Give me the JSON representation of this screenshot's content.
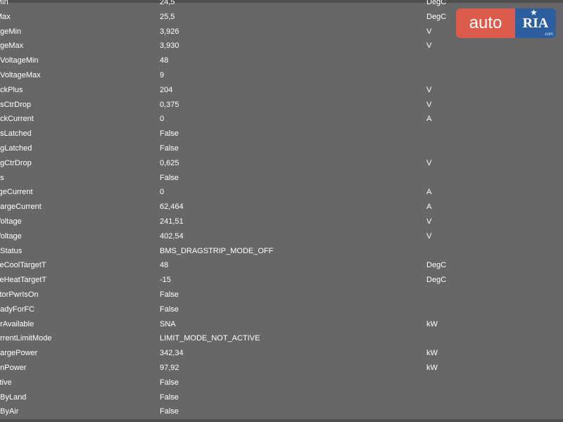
{
  "logo": {
    "brand_left": "auto",
    "brand_right": "RIA",
    "star_glyph": "★",
    "suffix": ".com",
    "color_left": "#db5c4c",
    "color_right": "#2c5ea0"
  },
  "rows": [
    {
      "name": "Min",
      "value": "24,5",
      "unit": "DegC"
    },
    {
      "name": "Max",
      "value": "25,5",
      "unit": "DegC"
    },
    {
      "name": "ageMin",
      "value": "3,926",
      "unit": "V"
    },
    {
      "name": "ageMax",
      "value": "3,930",
      "unit": "V"
    },
    {
      "name": "nVoltageMin",
      "value": "48",
      "unit": ""
    },
    {
      "name": "nVoltageMax",
      "value": "9",
      "unit": ""
    },
    {
      "name": "ackPlus",
      "value": "204",
      "unit": "V"
    },
    {
      "name": "osCtrDrop",
      "value": "0,375",
      "unit": "V"
    },
    {
      "name": "ackCurrent",
      "value": "0",
      "unit": "A"
    },
    {
      "name": "osLatched",
      "value": "False",
      "unit": ""
    },
    {
      "name": "egLatched",
      "value": "False",
      "unit": ""
    },
    {
      "name": "egCtrDrop",
      "value": "0,625",
      "unit": "V"
    },
    {
      "name": "os",
      "value": "False",
      "unit": ""
    },
    {
      "name": "rgeCurrent",
      "value": "0",
      "unit": "A"
    },
    {
      "name": "hargeCurrent",
      "value": "62,464",
      "unit": "A"
    },
    {
      "name": "Voltage",
      "value": "241,51",
      "unit": "V"
    },
    {
      "name": "Voltage",
      "value": "402,54",
      "unit": "V"
    },
    {
      "name": "pStatus",
      "value": "BMS_DRAGSTRIP_MODE_OFF",
      "unit": ""
    },
    {
      "name": "veCoolTargetT",
      "value": "48",
      "unit": "DegC"
    },
    {
      "name": "veHeatTargetT",
      "value": "-15",
      "unit": "DegC"
    },
    {
      "name": "ctorPwrIsOn",
      "value": "False",
      "unit": ""
    },
    {
      "name": "eadyForFC",
      "value": "False",
      "unit": ""
    },
    {
      "name": "erAvailable",
      "value": "SNA",
      "unit": "kW"
    },
    {
      "name": "urrentLimitMode",
      "value": "LIMIT_MODE_NOT_ACTIVE",
      "unit": ""
    },
    {
      "name": "hargePower",
      "value": "342,34",
      "unit": "kW"
    },
    {
      "name": "enPower",
      "value": "97,92",
      "unit": "kW"
    },
    {
      "name": "ctive",
      "value": "False",
      "unit": ""
    },
    {
      "name": "pByLand",
      "value": "False",
      "unit": ""
    },
    {
      "name": "pByAir",
      "value": "False",
      "unit": ""
    }
  ]
}
